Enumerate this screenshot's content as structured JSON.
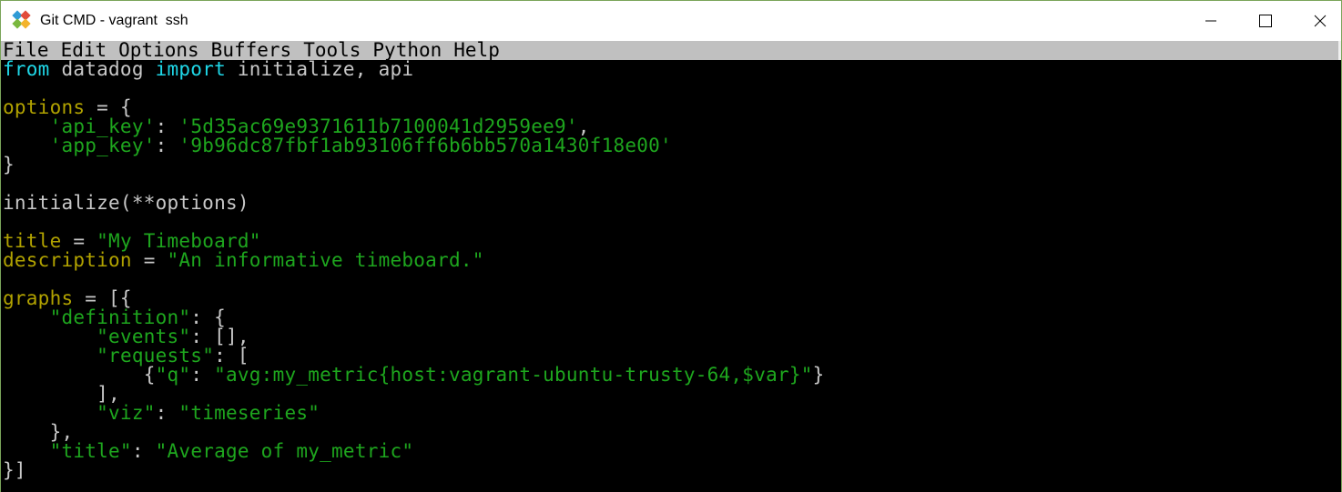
{
  "window": {
    "title": "Git CMD - vagrant  ssh",
    "border_color": "#7aa55a",
    "icon": "git-icon"
  },
  "controls": {
    "minimize_icon": "minimize-icon",
    "maximize_icon": "maximize-icon",
    "close_icon": "close-icon"
  },
  "menu": {
    "items": [
      "File",
      "Edit",
      "Options",
      "Buffers",
      "Tools",
      "Python",
      "Help"
    ]
  },
  "colors": {
    "keyword": "#1fd8e8",
    "plain": "#c8c8c8",
    "variable": "#b1a200",
    "string": "#1ea61e",
    "background": "#000000",
    "menubar": "#c0c0c0"
  },
  "code": {
    "lines": [
      [
        {
          "t": "kw",
          "v": "from"
        },
        {
          "t": "plain",
          "v": " datadog "
        },
        {
          "t": "kw",
          "v": "import"
        },
        {
          "t": "plain",
          "v": " initialize, api"
        }
      ],
      [],
      [
        {
          "t": "var",
          "v": "options"
        },
        {
          "t": "plain",
          "v": " = {"
        }
      ],
      [
        {
          "t": "plain",
          "v": "    "
        },
        {
          "t": "str",
          "v": "'api_key'"
        },
        {
          "t": "plain",
          "v": ": "
        },
        {
          "t": "str",
          "v": "'5d35ac69e9371611b7100041d2959ee9'"
        },
        {
          "t": "plain",
          "v": ","
        }
      ],
      [
        {
          "t": "plain",
          "v": "    "
        },
        {
          "t": "str",
          "v": "'app_key'"
        },
        {
          "t": "plain",
          "v": ": "
        },
        {
          "t": "str",
          "v": "'9b96dc87fbf1ab93106ff6b6bb570a1430f18e00'"
        }
      ],
      [
        {
          "t": "plain",
          "v": "}"
        }
      ],
      [],
      [
        {
          "t": "plain",
          "v": "initialize(**options)"
        }
      ],
      [],
      [
        {
          "t": "var",
          "v": "title"
        },
        {
          "t": "plain",
          "v": " = "
        },
        {
          "t": "str",
          "v": "\"My Timeboard\""
        }
      ],
      [
        {
          "t": "var",
          "v": "description"
        },
        {
          "t": "plain",
          "v": " = "
        },
        {
          "t": "str",
          "v": "\"An informative timeboard.\""
        }
      ],
      [],
      [
        {
          "t": "var",
          "v": "graphs"
        },
        {
          "t": "plain",
          "v": " = [{"
        }
      ],
      [
        {
          "t": "plain",
          "v": "    "
        },
        {
          "t": "str",
          "v": "\"definition\""
        },
        {
          "t": "plain",
          "v": ": {"
        }
      ],
      [
        {
          "t": "plain",
          "v": "        "
        },
        {
          "t": "str",
          "v": "\"events\""
        },
        {
          "t": "plain",
          "v": ": [],"
        }
      ],
      [
        {
          "t": "plain",
          "v": "        "
        },
        {
          "t": "str",
          "v": "\"requests\""
        },
        {
          "t": "plain",
          "v": ": ["
        }
      ],
      [
        {
          "t": "plain",
          "v": "            {"
        },
        {
          "t": "str",
          "v": "\"q\""
        },
        {
          "t": "plain",
          "v": ": "
        },
        {
          "t": "str",
          "v": "\"avg:my_metric{host:vagrant-ubuntu-trusty-64,$var}\""
        },
        {
          "t": "plain",
          "v": "}"
        }
      ],
      [
        {
          "t": "plain",
          "v": "        ],"
        }
      ],
      [
        {
          "t": "plain",
          "v": "        "
        },
        {
          "t": "str",
          "v": "\"viz\""
        },
        {
          "t": "plain",
          "v": ": "
        },
        {
          "t": "str",
          "v": "\"timeseries\""
        }
      ],
      [
        {
          "t": "plain",
          "v": "    },"
        }
      ],
      [
        {
          "t": "plain",
          "v": "    "
        },
        {
          "t": "str",
          "v": "\"title\""
        },
        {
          "t": "plain",
          "v": ": "
        },
        {
          "t": "str",
          "v": "\"Average of my_metric\""
        }
      ],
      [
        {
          "t": "plain",
          "v": "}]"
        }
      ]
    ]
  }
}
